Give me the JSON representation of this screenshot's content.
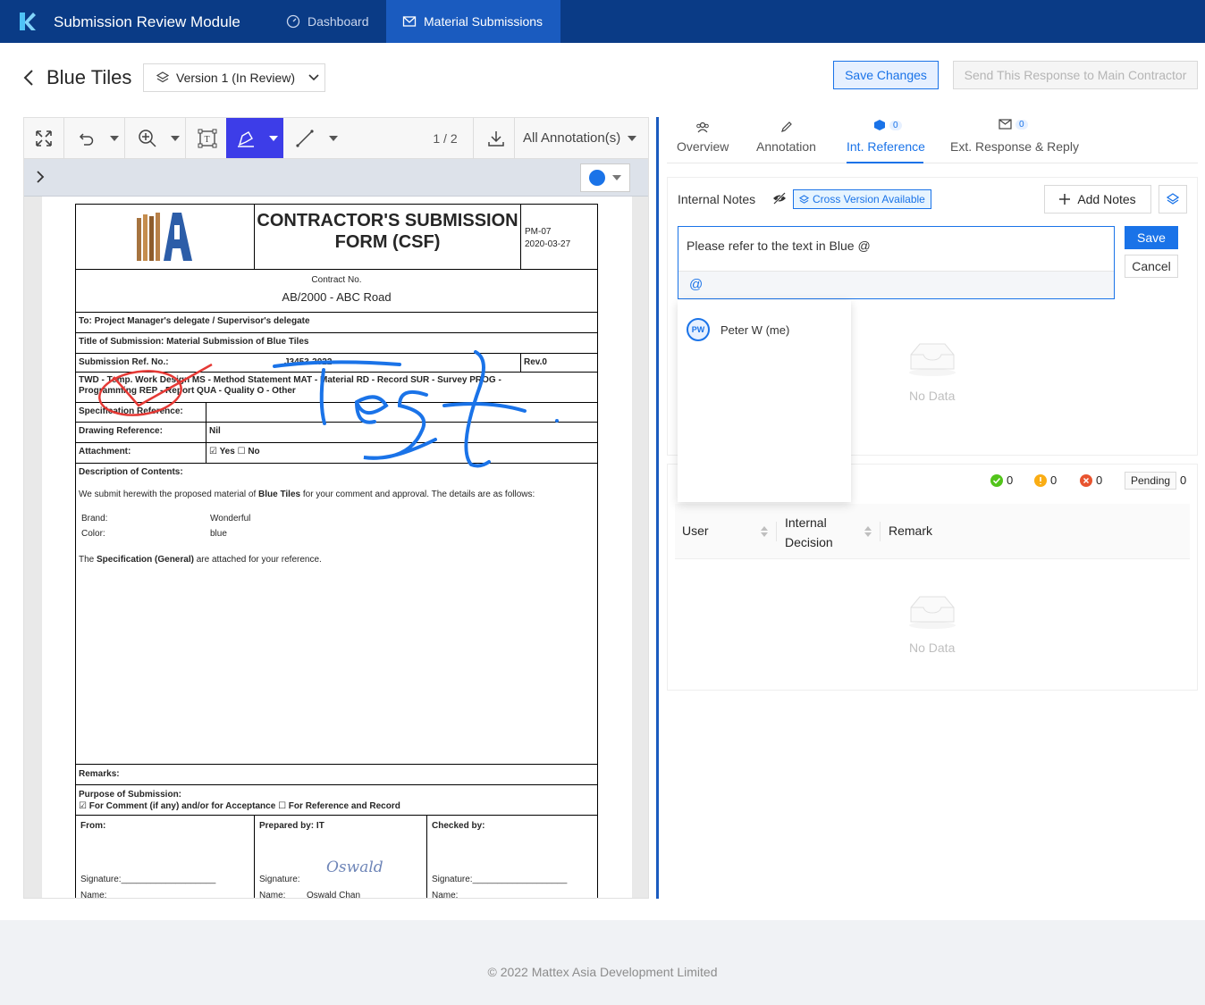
{
  "app": {
    "title": "Submission Review Module"
  },
  "nav": {
    "dashboard": "Dashboard",
    "material_submissions": "Material Submissions"
  },
  "header": {
    "title": "Blue Tiles",
    "version": "Version 1 (In Review)",
    "save_changes": "Save Changes",
    "send_response": "Send This Response to Main Contractor"
  },
  "toolbar": {
    "page": "1 / 2",
    "annotation_filter": "All Annotation(s)",
    "color": "#1a73e8"
  },
  "document": {
    "form_title": "CONTRACTOR'S SUBMISSION FORM (CSF)",
    "form_code": "PM-07",
    "form_date": "2020-03-27",
    "contract_label": "Contract No.",
    "contract_value": "AB/2000 - ABC Road",
    "to": "To: Project Manager's delegate / Supervisor's delegate",
    "title_of_submission": "Title of Submission: Material Submission of Blue Tiles",
    "ref_label": "Submission Ref. No.:",
    "ref_value": "J3453-2022",
    "rev": "Rev.0",
    "types_line1": "TWD - Temp. Work Design   MS - Method Statement   MAT - Material   RD - Record   SUR - Survey   PROG -",
    "types_line2": "Programming   REP - Report   QUA - Quality   O - Other",
    "spec_ref": "Specification Reference:",
    "drawing_ref": "Drawing Reference:",
    "drawing_val": "Nil",
    "attachment": "Attachment:",
    "attachment_val": "☑ Yes ☐ No",
    "desc_label": "Description of Contents:",
    "desc_text_pre": "We submit herewith the proposed material of ",
    "desc_text_bold": "Blue Tiles",
    "desc_text_post": " for your comment and approval. The details are as follows:",
    "brand_label": "Brand:",
    "brand_val": "Wonderful",
    "color_label": "Color:",
    "color_val": "blue",
    "spec_pre": "The ",
    "spec_bold": "Specification (General)",
    "spec_post": " are attached for your reference.",
    "remarks": "Remarks:",
    "purpose": "Purpose of Submission:",
    "purpose_opts": "☑ For Comment (if any) and/or for Acceptance ☐ For Reference and Record",
    "from": "From:",
    "prepared_by": "Prepared by: IT",
    "checked_by": "Checked by:",
    "signature": "Signature:___________________",
    "signature_short": "Signature:",
    "name": "Name:",
    "name_val": "Oswald Chan",
    "sign_script": "Oswald",
    "annotation_text": "Test"
  },
  "tabs": [
    {
      "label": "Overview"
    },
    {
      "label": "Annotation"
    },
    {
      "label": "Int. Reference",
      "count": "0"
    },
    {
      "label": "Ext. Response & Reply",
      "count": "0"
    }
  ],
  "notes": {
    "title": "Internal Notes",
    "cross_version": "Cross Version Available",
    "add_notes": "Add Notes",
    "input_value": "Please refer to the text in Blue @",
    "at": "@",
    "save": "Save",
    "cancel": "Cancel",
    "mention_user": "Peter W (me)",
    "mention_initials": "PW",
    "no_data": "No Data"
  },
  "decisions": {
    "approved": "0",
    "warning": "0",
    "rejected": "0",
    "pending_label": "Pending",
    "pending": "0",
    "columns": [
      "User",
      "Internal Decision",
      "Remark"
    ],
    "no_data": "No Data"
  },
  "footer": "2022 Mattex Asia Development Limited"
}
